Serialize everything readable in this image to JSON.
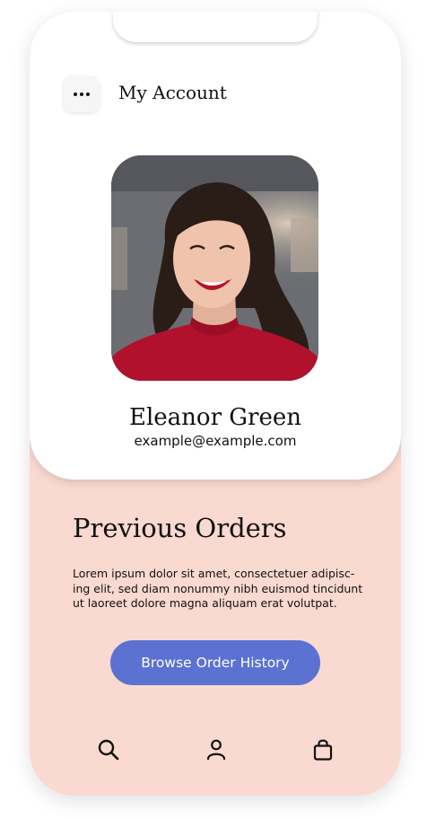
{
  "header": {
    "title": "My Account",
    "menu_icon": "more-dots-icon"
  },
  "profile": {
    "name": "Eleanor Green",
    "email": "example@example.com",
    "photo_icon": "profile-photo"
  },
  "orders": {
    "heading": "Previous Orders",
    "body": "Lorem ipsum dolor sit amet, consectetuer adipisc-ing elit, sed diam nonummy nibh euismod tincidunt ut laoreet dolore magna aliquam erat volutpat.",
    "button_label": "Browse Order History"
  },
  "bottom_nav": {
    "items": [
      {
        "icon": "search-icon"
      },
      {
        "icon": "user-icon"
      },
      {
        "icon": "shopping-bag-icon"
      }
    ]
  },
  "colors": {
    "accent": "#5b72d3",
    "lower_background": "#fad9d0",
    "card_background": "#ffffff"
  }
}
